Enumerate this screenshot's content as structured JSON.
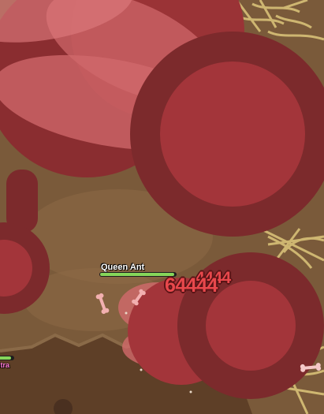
{
  "boss": {
    "name": "Queen Ant",
    "health_fraction": 0.98
  },
  "damage_numbers": [
    "64444",
    "4444"
  ],
  "player": {
    "name_fragment": "ltra",
    "health_fraction": 0.85
  },
  "colors": {
    "ground": "#7a5a3a",
    "dirt_dark": "#6b4a2e",
    "ant_body": "#a3353a",
    "ant_outline": "#7c2a2c",
    "wing": "#d9888a",
    "web": "#d8c178",
    "health_green": "#86d65a",
    "damage_text": "#e8484c",
    "name_pink": "#ff7ad9"
  },
  "icons": [
    "bone-icon",
    "bone-icon",
    "bone-icon",
    "bone-icon",
    "spider-web-icon"
  ]
}
